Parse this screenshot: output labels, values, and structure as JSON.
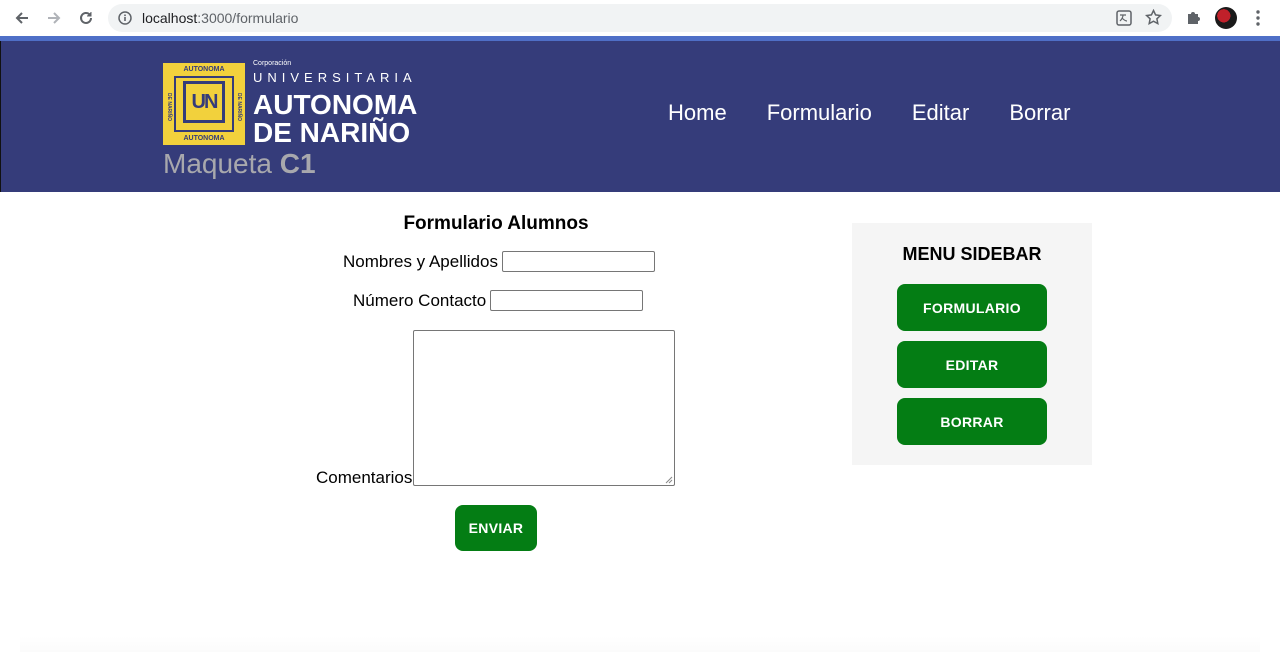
{
  "browser": {
    "url_host": "localhost",
    "url_path": ":3000/formulario"
  },
  "header": {
    "logo": {
      "corporation": "Corporación",
      "universitaria": "UNIVERSITARIA",
      "autonoma": "AUTONOMA",
      "narino": "DE NARIÑO",
      "seal_top": "AUTONOMA",
      "seal_bottom": "AUTONOMA",
      "seal_left": "DE NARIÑO",
      "seal_right": "DE NARIÑO",
      "seal_mark": "UN"
    },
    "subtitle_regular": "Maqueta ",
    "subtitle_bold": "C1",
    "nav": [
      "Home",
      "Formulario",
      "Editar",
      "Borrar"
    ]
  },
  "form": {
    "title": "Formulario Alumnos",
    "name_label": "Nombres y Apellidos",
    "phone_label": "Número Contacto",
    "comments_label": "Comentarios",
    "submit_label": "ENVIAR"
  },
  "sidebar": {
    "title": "MENU SIDEBAR",
    "buttons": [
      "FORMULARIO",
      "EDITAR",
      "BORRAR"
    ]
  },
  "colors": {
    "header_bg": "#353c7a",
    "accent": "#4f6fc7",
    "button_green": "#047d14",
    "logo_yellow": "#f2d13c"
  }
}
